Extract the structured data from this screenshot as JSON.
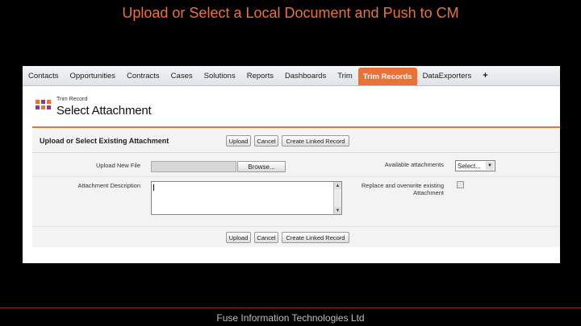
{
  "slide": {
    "title": "Upload or Select a Local Document and Push to CM",
    "footer": "Fuse Information Technologies Ltd"
  },
  "tabs": [
    {
      "label": "Contacts",
      "active": false
    },
    {
      "label": "Opportunities",
      "active": false
    },
    {
      "label": "Contracts",
      "active": false
    },
    {
      "label": "Cases",
      "active": false
    },
    {
      "label": "Solutions",
      "active": false
    },
    {
      "label": "Reports",
      "active": false
    },
    {
      "label": "Dashboards",
      "active": false
    },
    {
      "label": "Trim",
      "active": false
    },
    {
      "label": "Trim Records",
      "active": true
    },
    {
      "label": "DataExporters",
      "active": false
    },
    {
      "label": "+",
      "active": false
    }
  ],
  "header": {
    "subtitle": "Trim Record",
    "title": "Select Attachment",
    "icon": "trim-logo-icon"
  },
  "panel": {
    "title": "Upload or Select Existing Attachment",
    "buttons": {
      "upload": "Upload",
      "cancel": "Cancel",
      "create_linked": "Create Linked Record"
    },
    "fields": {
      "upload_new_file_label": "Upload New File",
      "browse_label": "Browse...",
      "available_attachments_label": "Available attachments",
      "available_attachments_value": "Select...",
      "attachment_description_label": "Attachment Description",
      "attachment_description_value": "",
      "replace_label_line1": "Replace and overwrite existing",
      "replace_label_line2": "Attachment",
      "replace_checked": false
    }
  },
  "colors": {
    "accent": "#e8733a",
    "background": "#000000",
    "panel_background": "#f3f3f3"
  }
}
